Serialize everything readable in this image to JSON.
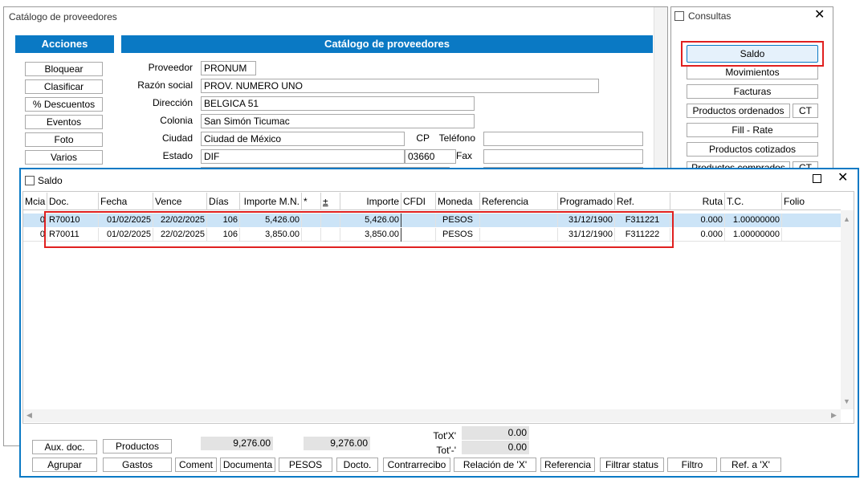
{
  "main_window": {
    "title": "Catálogo de proveedores"
  },
  "acciones": {
    "header": "Acciones",
    "buttons": [
      "Bloquear",
      "Clasificar",
      "% Descuentos",
      "Eventos",
      "Foto",
      "Varios"
    ]
  },
  "catalogo": {
    "header": "Catálogo de proveedores",
    "proveedor_label": "Proveedor",
    "proveedor": "PRONUM",
    "razon_label": "Razón social",
    "razon": "PROV. NUMERO UNO",
    "direccion_label": "Dirección",
    "direccion": "BELGICA 51",
    "colonia_label": "Colonia",
    "colonia": "San Simón Ticumac",
    "ciudad_label": "Ciudad",
    "ciudad": "Ciudad de México",
    "cp_label": "CP",
    "telefono_label": "Teléfono",
    "telefono": "",
    "estado_label": "Estado",
    "estado": "DIF",
    "cp": "03660",
    "fax_label": "Fax",
    "fax": ""
  },
  "consultas": {
    "title": "Consultas",
    "saldo": "Saldo",
    "movimientos": "Movimientos",
    "facturas": "Facturas",
    "productos_ordenados": "Productos ordenados",
    "ct1": "CT",
    "fill_rate": "Fill - Rate",
    "productos_cotizados": "Productos cotizados",
    "productos_comprados": "Productos comprados",
    "ct2": "CT"
  },
  "saldo_window": {
    "title": "Saldo",
    "columns": [
      "Mcia",
      "Doc.",
      "Fecha",
      "Vence",
      "Días",
      "Importe M.N.",
      "*",
      "±",
      "Importe",
      "CFDI",
      "Moneda",
      "Referencia",
      "Programado",
      "Ref.",
      "Ruta",
      "T.C.",
      "Folio"
    ],
    "rows": [
      {
        "mcia": "0",
        "doc": "R70010",
        "fecha": "01/02/2025",
        "vence": "22/02/2025",
        "dias": "106",
        "importe_mn": "5,426.00",
        "star": "",
        "pm": "",
        "importe": "5,426.00",
        "cfdi": "",
        "moneda": "PESOS",
        "referencia": "",
        "programado": "31/12/1900",
        "ref": "F311221",
        "ruta": "0.000",
        "tc": "1.00000000",
        "folio": ""
      },
      {
        "mcia": "0",
        "doc": "R70011",
        "fecha": "01/02/2025",
        "vence": "22/02/2025",
        "dias": "106",
        "importe_mn": "3,850.00",
        "star": "",
        "pm": "",
        "importe": "3,850.00",
        "cfdi": "",
        "moneda": "PESOS",
        "referencia": "",
        "programado": "31/12/1900",
        "ref": "F311222",
        "ruta": "0.000",
        "tc": "1.00000000",
        "folio": ""
      }
    ],
    "total_mn": "9,276.00",
    "total_importe": "9,276.00",
    "tot_x_label": "Tot'X'",
    "tot_x": "0.00",
    "tot_minus_label": "Tot'-'",
    "tot_minus": "0.00",
    "buttons_row1": [
      "Aux. doc.",
      "Productos"
    ],
    "buttons_row2": [
      "Agrupar",
      "Gastos",
      "Coment",
      "Documenta",
      "PESOS",
      "Docto.",
      "Contrarrecibo",
      "Relación de 'X'",
      "Referencia",
      "Filtrar status",
      "Filtro",
      "Ref. a 'X'"
    ]
  },
  "colors": {
    "accent": "#0a79c4",
    "highlight": "#e0201f",
    "selected_row": "#cce4f7"
  }
}
